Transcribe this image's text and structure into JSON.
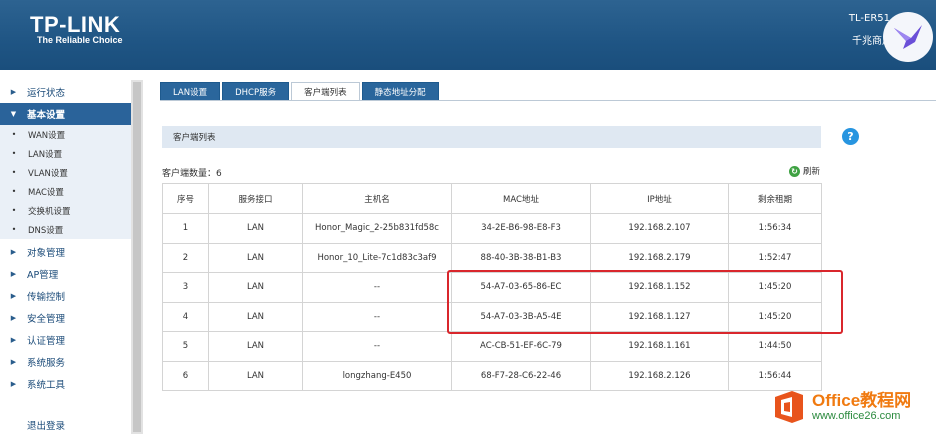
{
  "header": {
    "logo": "TP-LINK",
    "tagline": "The Reliable Choice",
    "model": "TL-ER51",
    "subtitle": "千兆商用"
  },
  "sidebar": {
    "items": [
      {
        "label": "运行状态",
        "active": false
      },
      {
        "label": "基本设置",
        "active": true
      },
      {
        "label": "对象管理",
        "active": false
      },
      {
        "label": "AP管理",
        "active": false
      },
      {
        "label": "传输控制",
        "active": false
      },
      {
        "label": "安全管理",
        "active": false
      },
      {
        "label": "认证管理",
        "active": false
      },
      {
        "label": "系统服务",
        "active": false
      },
      {
        "label": "系统工具",
        "active": false
      }
    ],
    "subitems": [
      "WAN设置",
      "LAN设置",
      "VLAN设置",
      "MAC设置",
      "交换机设置",
      "DNS设置"
    ],
    "logout": "退出登录"
  },
  "tabs": [
    "LAN设置",
    "DHCP服务",
    "客户端列表",
    "静态地址分配"
  ],
  "active_tab": "客户端列表",
  "section_title": "客户端列表",
  "client_count": "客户端数量：6",
  "refresh_label": "刷新",
  "help_label": "?",
  "table": {
    "headers": [
      "序号",
      "服务接口",
      "主机名",
      "MAC地址",
      "IP地址",
      "剩余租期"
    ],
    "rows": [
      [
        "1",
        "LAN",
        "Honor_Magic_2-25b831fd58c",
        "34-2E-B6-98-E8-F3",
        "192.168.2.107",
        "1:56:34"
      ],
      [
        "2",
        "LAN",
        "Honor_10_Lite-7c1d83c3af9",
        "88-40-3B-38-B1-B3",
        "192.168.2.179",
        "1:52:47"
      ],
      [
        "3",
        "LAN",
        "--",
        "54-A7-03-65-86-EC",
        "192.168.1.152",
        "1:45:20"
      ],
      [
        "4",
        "LAN",
        "--",
        "54-A7-03-3B-A5-4E",
        "192.168.1.127",
        "1:45:20"
      ],
      [
        "5",
        "LAN",
        "--",
        "AC-CB-51-EF-6C-79",
        "192.168.1.161",
        "1:44:50"
      ],
      [
        "6",
        "LAN",
        "longzhang-E450",
        "68-F7-28-C6-22-46",
        "192.168.2.126",
        "1:56:44"
      ]
    ]
  },
  "watermark": {
    "brand": "Office教程网",
    "url": "www.office26.com"
  },
  "colors": {
    "header_bg": "#1f5584",
    "tab_bg": "#2a669c",
    "highlight": "#d9262c",
    "help": "#2795e0",
    "refresh": "#3fa243"
  }
}
